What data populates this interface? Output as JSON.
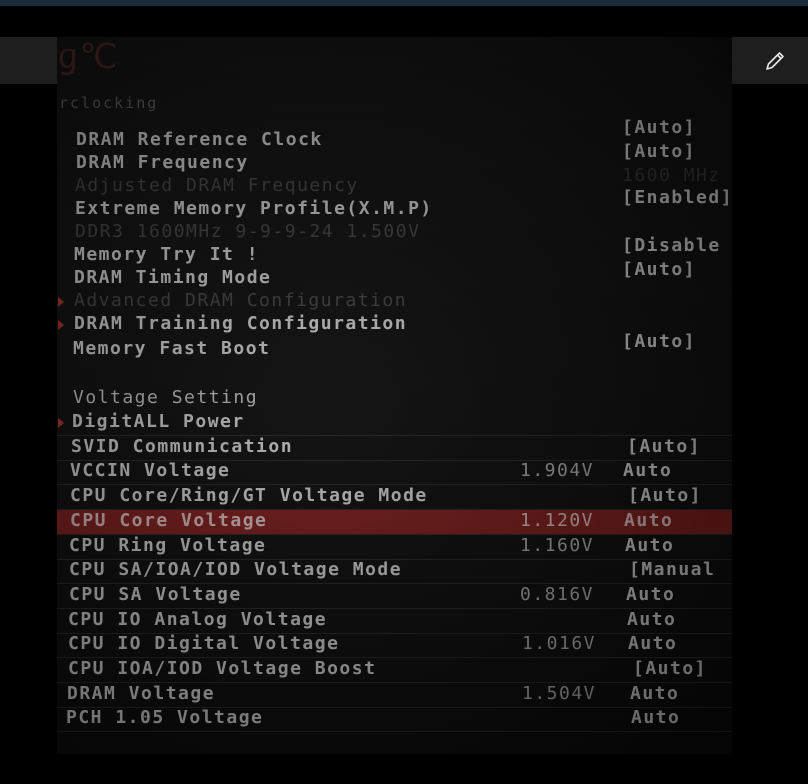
{
  "toolbar": {
    "icons": [
      "share-icon",
      "slideshow-icon",
      "edit-pencil-icon"
    ]
  },
  "bios": {
    "logo_text": "ɡ℃",
    "section_title": "rclocking",
    "dram_rows": [
      {
        "label": "DRAM Reference Clock",
        "value": "[Auto]"
      },
      {
        "label": "DRAM Frequency",
        "value": "[Auto]"
      },
      {
        "label": "Adjusted DRAM Frequency",
        "value": "1600 MHz"
      },
      {
        "label": "Extreme Memory Profile(X.M.P)",
        "value": "[Enabled]"
      },
      {
        "label": "DDR3 1600MHz 9-9-9-24 1.500V",
        "value": ""
      },
      {
        "label": "Memory Try It !",
        "value": "[Disable"
      },
      {
        "label": "DRAM Timing Mode",
        "value": "[Auto]"
      },
      {
        "label": "Advanced DRAM Configuration",
        "value": ""
      },
      {
        "label": "DRAM Training Configuration",
        "value": ""
      },
      {
        "label": "Memory Fast Boot",
        "value": "[Auto]"
      }
    ],
    "voltage_title": "Voltage Setting",
    "voltage_rows": [
      {
        "label": "DigitALL Power",
        "volt": "",
        "value": ""
      },
      {
        "label": "SVID Communication",
        "volt": "",
        "value": "[Auto]"
      },
      {
        "label": "VCCIN Voltage",
        "volt": "1.904V",
        "value": "Auto"
      },
      {
        "label": "CPU Core/Ring/GT Voltage Mode",
        "volt": "",
        "value": "[Auto]"
      },
      {
        "label": "CPU Core Voltage",
        "volt": "1.120V",
        "value": "Auto"
      },
      {
        "label": "CPU Ring Voltage",
        "volt": "1.160V",
        "value": "Auto"
      },
      {
        "label": "CPU SA/IOA/IOD Voltage Mode",
        "volt": "",
        "value": "[Manual"
      },
      {
        "label": "CPU SA Voltage",
        "volt": "0.816V",
        "value": "Auto"
      },
      {
        "label": "CPU IO Analog Voltage",
        "volt": "",
        "value": "Auto"
      },
      {
        "label": "CPU IO Digital Voltage",
        "volt": "1.016V",
        "value": "Auto"
      },
      {
        "label": "CPU IOA/IOD Voltage Boost",
        "volt": "",
        "value": "[Auto]"
      },
      {
        "label": "DRAM Voltage",
        "volt": "1.504V",
        "value": "Auto"
      },
      {
        "label": "PCH 1.05 Voltage",
        "volt": "",
        "value": "Auto"
      }
    ]
  },
  "colors": {
    "selected_row": "#8c1f1f",
    "submenu_arrow": "#c0392b"
  }
}
